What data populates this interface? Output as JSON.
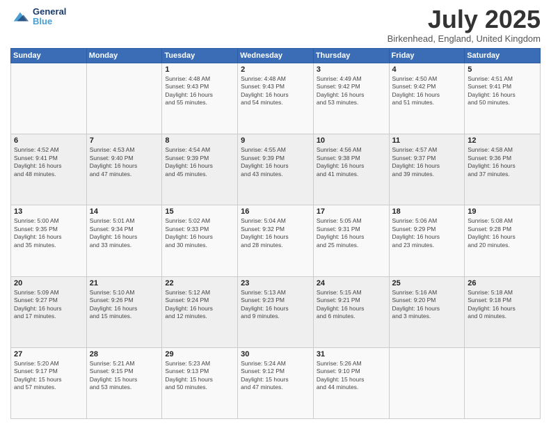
{
  "header": {
    "logo_line1": "General",
    "logo_line2": "Blue",
    "month": "July 2025",
    "location": "Birkenhead, England, United Kingdom"
  },
  "weekdays": [
    "Sunday",
    "Monday",
    "Tuesday",
    "Wednesday",
    "Thursday",
    "Friday",
    "Saturday"
  ],
  "weeks": [
    [
      {
        "day": "",
        "info": ""
      },
      {
        "day": "",
        "info": ""
      },
      {
        "day": "1",
        "info": "Sunrise: 4:48 AM\nSunset: 9:43 PM\nDaylight: 16 hours\nand 55 minutes."
      },
      {
        "day": "2",
        "info": "Sunrise: 4:48 AM\nSunset: 9:43 PM\nDaylight: 16 hours\nand 54 minutes."
      },
      {
        "day": "3",
        "info": "Sunrise: 4:49 AM\nSunset: 9:42 PM\nDaylight: 16 hours\nand 53 minutes."
      },
      {
        "day": "4",
        "info": "Sunrise: 4:50 AM\nSunset: 9:42 PM\nDaylight: 16 hours\nand 51 minutes."
      },
      {
        "day": "5",
        "info": "Sunrise: 4:51 AM\nSunset: 9:41 PM\nDaylight: 16 hours\nand 50 minutes."
      }
    ],
    [
      {
        "day": "6",
        "info": "Sunrise: 4:52 AM\nSunset: 9:41 PM\nDaylight: 16 hours\nand 48 minutes."
      },
      {
        "day": "7",
        "info": "Sunrise: 4:53 AM\nSunset: 9:40 PM\nDaylight: 16 hours\nand 47 minutes."
      },
      {
        "day": "8",
        "info": "Sunrise: 4:54 AM\nSunset: 9:39 PM\nDaylight: 16 hours\nand 45 minutes."
      },
      {
        "day": "9",
        "info": "Sunrise: 4:55 AM\nSunset: 9:39 PM\nDaylight: 16 hours\nand 43 minutes."
      },
      {
        "day": "10",
        "info": "Sunrise: 4:56 AM\nSunset: 9:38 PM\nDaylight: 16 hours\nand 41 minutes."
      },
      {
        "day": "11",
        "info": "Sunrise: 4:57 AM\nSunset: 9:37 PM\nDaylight: 16 hours\nand 39 minutes."
      },
      {
        "day": "12",
        "info": "Sunrise: 4:58 AM\nSunset: 9:36 PM\nDaylight: 16 hours\nand 37 minutes."
      }
    ],
    [
      {
        "day": "13",
        "info": "Sunrise: 5:00 AM\nSunset: 9:35 PM\nDaylight: 16 hours\nand 35 minutes."
      },
      {
        "day": "14",
        "info": "Sunrise: 5:01 AM\nSunset: 9:34 PM\nDaylight: 16 hours\nand 33 minutes."
      },
      {
        "day": "15",
        "info": "Sunrise: 5:02 AM\nSunset: 9:33 PM\nDaylight: 16 hours\nand 30 minutes."
      },
      {
        "day": "16",
        "info": "Sunrise: 5:04 AM\nSunset: 9:32 PM\nDaylight: 16 hours\nand 28 minutes."
      },
      {
        "day": "17",
        "info": "Sunrise: 5:05 AM\nSunset: 9:31 PM\nDaylight: 16 hours\nand 25 minutes."
      },
      {
        "day": "18",
        "info": "Sunrise: 5:06 AM\nSunset: 9:29 PM\nDaylight: 16 hours\nand 23 minutes."
      },
      {
        "day": "19",
        "info": "Sunrise: 5:08 AM\nSunset: 9:28 PM\nDaylight: 16 hours\nand 20 minutes."
      }
    ],
    [
      {
        "day": "20",
        "info": "Sunrise: 5:09 AM\nSunset: 9:27 PM\nDaylight: 16 hours\nand 17 minutes."
      },
      {
        "day": "21",
        "info": "Sunrise: 5:10 AM\nSunset: 9:26 PM\nDaylight: 16 hours\nand 15 minutes."
      },
      {
        "day": "22",
        "info": "Sunrise: 5:12 AM\nSunset: 9:24 PM\nDaylight: 16 hours\nand 12 minutes."
      },
      {
        "day": "23",
        "info": "Sunrise: 5:13 AM\nSunset: 9:23 PM\nDaylight: 16 hours\nand 9 minutes."
      },
      {
        "day": "24",
        "info": "Sunrise: 5:15 AM\nSunset: 9:21 PM\nDaylight: 16 hours\nand 6 minutes."
      },
      {
        "day": "25",
        "info": "Sunrise: 5:16 AM\nSunset: 9:20 PM\nDaylight: 16 hours\nand 3 minutes."
      },
      {
        "day": "26",
        "info": "Sunrise: 5:18 AM\nSunset: 9:18 PM\nDaylight: 16 hours\nand 0 minutes."
      }
    ],
    [
      {
        "day": "27",
        "info": "Sunrise: 5:20 AM\nSunset: 9:17 PM\nDaylight: 15 hours\nand 57 minutes."
      },
      {
        "day": "28",
        "info": "Sunrise: 5:21 AM\nSunset: 9:15 PM\nDaylight: 15 hours\nand 53 minutes."
      },
      {
        "day": "29",
        "info": "Sunrise: 5:23 AM\nSunset: 9:13 PM\nDaylight: 15 hours\nand 50 minutes."
      },
      {
        "day": "30",
        "info": "Sunrise: 5:24 AM\nSunset: 9:12 PM\nDaylight: 15 hours\nand 47 minutes."
      },
      {
        "day": "31",
        "info": "Sunrise: 5:26 AM\nSunset: 9:10 PM\nDaylight: 15 hours\nand 44 minutes."
      },
      {
        "day": "",
        "info": ""
      },
      {
        "day": "",
        "info": ""
      }
    ]
  ]
}
